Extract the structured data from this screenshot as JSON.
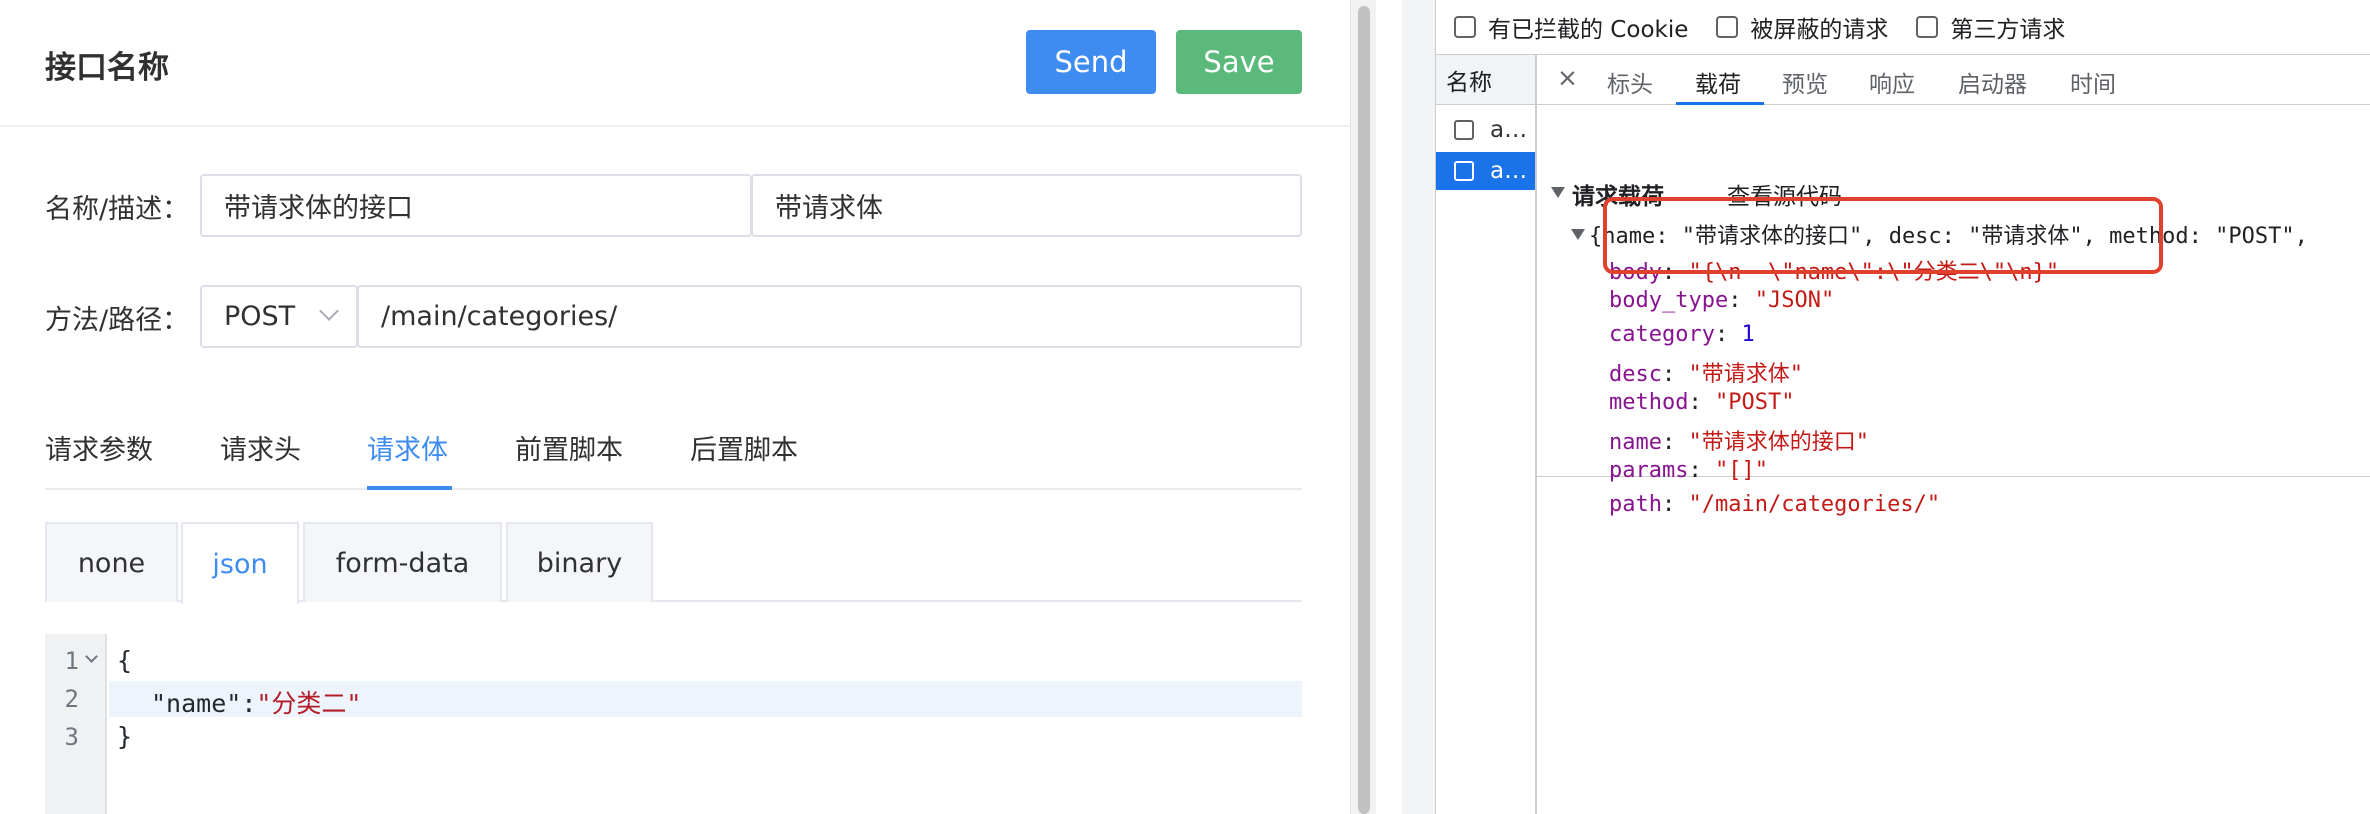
{
  "header": {
    "title": "接口名称",
    "send_label": "Send",
    "save_label": "Save"
  },
  "form": {
    "name_label": "名称/描述：",
    "name_value": "带请求体的接口",
    "desc_value": "带请求体",
    "method_label": "方法/路径：",
    "method_value": "POST",
    "path_value": "/main/categories/"
  },
  "tabs": [
    {
      "label": "请求参数"
    },
    {
      "label": "请求头"
    },
    {
      "label": "请求体",
      "active": true
    },
    {
      "label": "前置脚本"
    },
    {
      "label": "后置脚本"
    }
  ],
  "body_tabs": [
    {
      "label": "none"
    },
    {
      "label": "json",
      "active": true
    },
    {
      "label": "form-data"
    },
    {
      "label": "binary"
    }
  ],
  "editor": {
    "line_numbers": [
      "1",
      "2",
      "3"
    ],
    "line1": "{",
    "line2_key": "\"name\"",
    "line2_colon": ":",
    "line2_value": "\"分类二\"",
    "line3": "}"
  },
  "devtools": {
    "filters": [
      "有已拦截的 Cookie",
      "被屏蔽的请求",
      "第三方请求"
    ],
    "name_header": "名称",
    "requests": [
      {
        "label": "a…",
        "selected": false
      },
      {
        "label": "a…",
        "selected": true
      }
    ],
    "close_label": "×",
    "tabs": [
      {
        "label": "标头"
      },
      {
        "label": "载荷",
        "active": true
      },
      {
        "label": "预览"
      },
      {
        "label": "响应"
      },
      {
        "label": "启动器"
      },
      {
        "label": "时间"
      }
    ],
    "payload": {
      "section_title": "请求载荷",
      "view_source": "查看源代码",
      "summary": "{name: \"带请求体的接口\", desc: \"带请求体\", method: \"POST\",",
      "fields": [
        {
          "key": "body",
          "value": "\"{\\n  \\\"name\\\":\\\"分类二\\\"\\n}\""
        },
        {
          "key": "body_type",
          "value": "\"JSON\""
        },
        {
          "key": "category",
          "value": "1"
        },
        {
          "key": "desc",
          "value": "\"带请求体\""
        },
        {
          "key": "method",
          "value": "\"POST\""
        },
        {
          "key": "name",
          "value": "\"带请求体的接口\""
        },
        {
          "key": "params",
          "value": "\"[]\""
        },
        {
          "key": "path",
          "value": "\"/main/categories/\""
        }
      ]
    }
  },
  "colors": {
    "primary": "#3f8cf0",
    "save_green": "#5bb97c",
    "devtools_blue": "#1a73e8",
    "highlight_red": "#e0412c"
  }
}
